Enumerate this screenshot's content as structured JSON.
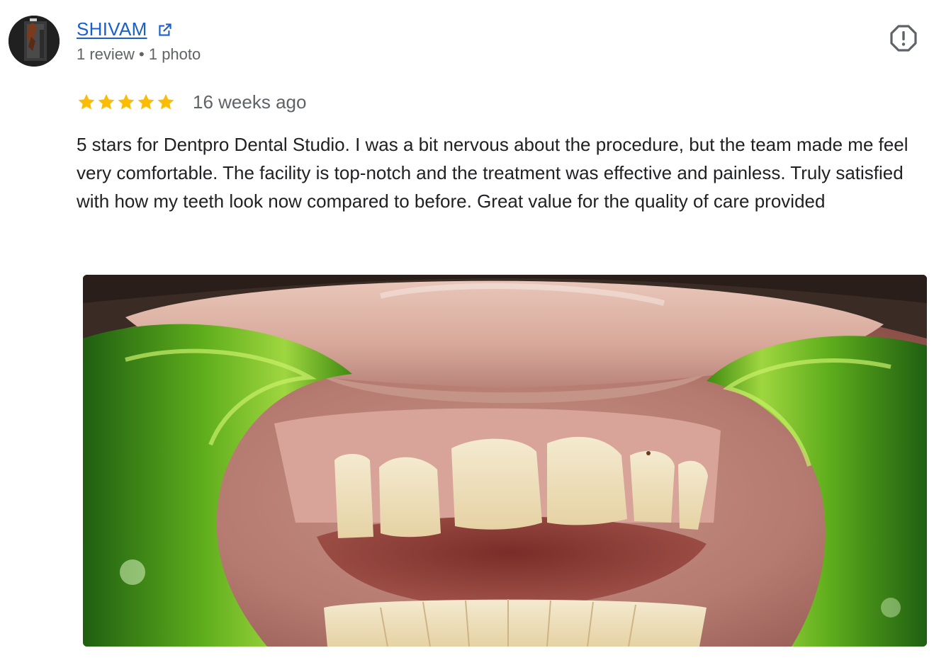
{
  "review": {
    "author": {
      "name": "SHIVAM",
      "meta": "1 review • 1 photo",
      "avatar_icon": "avatar-photo",
      "link_icon": "open-in-new-icon"
    },
    "rating": {
      "stars": 5,
      "max": 5,
      "color": "#fbbc04"
    },
    "time_ago": "16 weeks ago",
    "text": "5 stars for Dentpro Dental Studio. I was a bit nervous about the procedure, but the team made me feel very comfortable. The facility is top-notch and the treatment was effective and painless. Truly satisfied with how my teeth look now compared to before. Great value for the quality of care provided",
    "report_icon": "report-icon",
    "photo_icon": "review-photo",
    "colors": {
      "link": "#1a5fd0",
      "secondary": "#5f6368",
      "text": "#202124"
    }
  }
}
